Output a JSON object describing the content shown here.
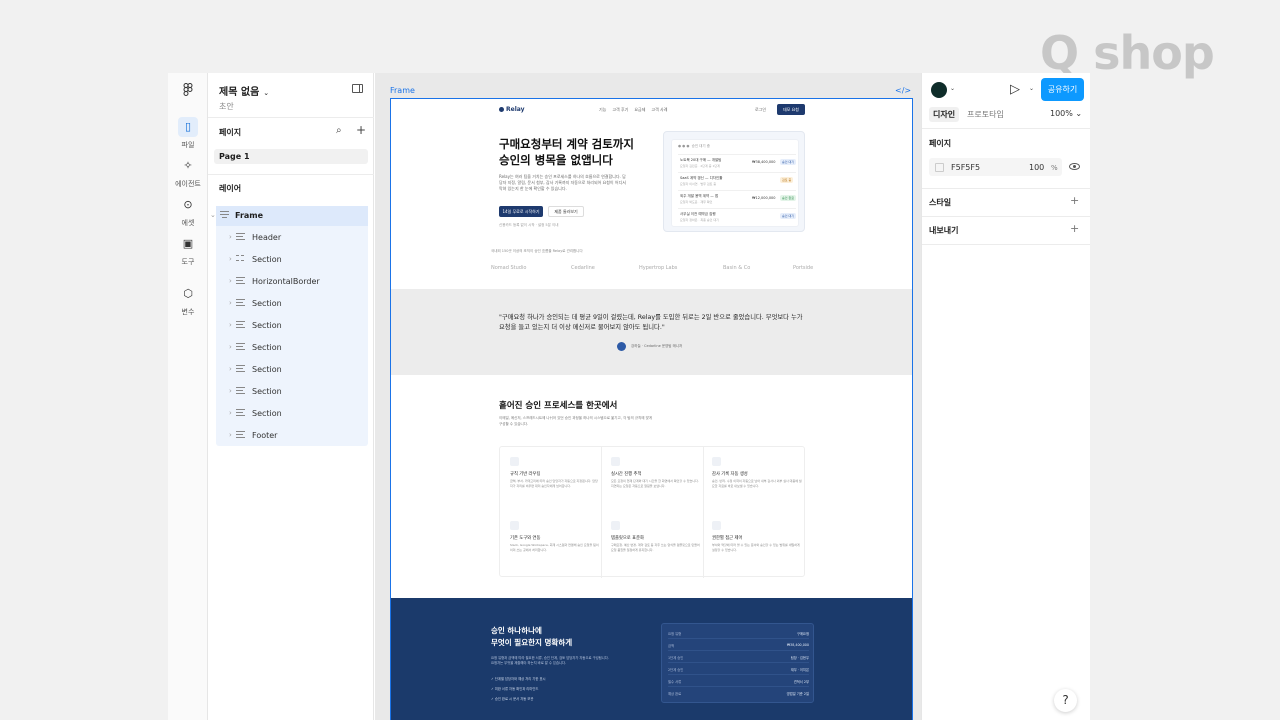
{
  "brand": "Q shop",
  "rail": [
    {
      "label": "파일",
      "icon": "file-icon",
      "active": true
    },
    {
      "label": "에이전트",
      "icon": "sparkle-icon"
    },
    {
      "label": "에셋",
      "icon": "asset-icon"
    },
    {
      "label": "도구",
      "icon": "toolbox-icon"
    },
    {
      "label": "변수",
      "icon": "variable-icon"
    }
  ],
  "layers_panel": {
    "title": "제목 없음",
    "subtitle": "초안",
    "pages_label": "페이지",
    "page": "Page 1",
    "layers_label": "레이어",
    "frame": "Frame",
    "children": [
      "Header",
      "Section",
      "HorizontalBorder",
      "Section",
      "Section",
      "Section",
      "Section",
      "Section",
      "Section",
      "Footer"
    ]
  },
  "canvas": {
    "frame_label": "Frame",
    "code_label": "</>"
  },
  "site": {
    "logo": "Relay",
    "nav": [
      "기능",
      "고객 후기",
      "요금제",
      "고객 사례"
    ],
    "login": "로그인",
    "cta": "데모 요청",
    "hero_title_1": "구매요청부터 계약 검토까지",
    "hero_title_2": "승인의 병목을 없앱니다",
    "hero_desc": "Relay는 여러 팀을 거치는 승인 프로세스를 하나의 흐름으로 연결합니다. 담당자 지정, 알림, 문서 첨부, 감사 기록까지 자동으로 처리되어 요청이 어디서 막혀 있는지 한 눈에 확인할 수 있습니다.",
    "hero_btn_primary": "14일 무료로 시작하기",
    "hero_btn_secondary": "제품 둘러보기",
    "hero_note": "신용카드 등록 없이 시작 · 설정 5분 이내",
    "mock_title": "승인 대기 중",
    "mock_rows": [
      {
        "t": "노트북 20대 구매 — 개발팀",
        "s": "요청자 김민준 · 2단계 중 1단계",
        "a": "₩38,400,000",
        "b": "승인 대기"
      },
      {
        "t": "SaaS 계약 갱신 — 디자인툴",
        "s": "요청자 이서연 · 법무 검토 중",
        "a": "",
        "b": "검토 중"
      },
      {
        "t": "외주 개발 용역 계약 — 앱",
        "s": "요청자 박도윤 · 재무 확인",
        "a": "₩12,000,000",
        "b": "승인 완료"
      },
      {
        "t": "사무실 이전 예약금 집행",
        "s": "요청자 정하은 · 최종 승인 대기",
        "a": "",
        "b": "승인 대기"
      }
    ],
    "trust": "국내외 150곳 이상의 조직이 승인 흐름을 Relay로 관리합니다",
    "logos": [
      "Nomad Studio",
      "Cedarline",
      "Hypertrop Labs",
      "Basin & Co",
      "Portside"
    ],
    "quote": "\"구매요청 하나가 승인되는 데 평균 9일이 걸렸는데, Relay를 도입한 뒤로는 2일 반으로 줄었습니다. 무엇보다 누가 요청을 들고 있는지 더 이상 메신저로 물어보지 않아도 됩니다.\"",
    "quote_author": "강하늘 · Cedarline 운영팀 매니저",
    "features_title": "흩어진 승인 프로세스를 한곳에서",
    "features_desc": "이메일, 메신저, 스프레드시트에 나뉘어 있던 승인 과정을 하나의 시스템으로 옮기고, 각 팀의 규칙에 맞게 구성할 수 있습니다.",
    "features": [
      {
        "t": "규칙 기반 라우팅",
        "d": "금액, 부서, 카테고리에 따라 승인 담당자가 자동으로 지정됩니다. 담당자가 자리를 비우면 대리 승인자에게 넘어갑니다."
      },
      {
        "t": "실시간 진행 추적",
        "d": "모든 요청의 현재 단계와 대기 시간을 한 화면에서 확인할 수 있습니다. 지연되는 요청은 자동으로 알림을 보냅니다."
      },
      {
        "t": "감사 기록 자동 생성",
        "d": "승인, 반려, 수정 이력이 자동으로 남아 내부 감사나 외부 실사 대응에 필요한 자료를 바로 내보낼 수 있습니다."
      },
      {
        "t": "기존 도구와 연동",
        "d": "Slack, Google Workspace, 회계 시스템과 연결해 승인 요청을 팀이 이미 쓰는 곳에서 처리합니다."
      },
      {
        "t": "템플릿으로 표준화",
        "d": "구매요청, 예산 변경, 계약 검토 등 자주 쓰는 양식을 템플릿으로 만들어 요청 품질을 일정하게 유지합니다."
      },
      {
        "t": "권한별 접근 제어",
        "d": "부서와 역할에 따라 볼 수 있는 문서와 승인할 수 있는 범위를 세밀하게 설정할 수 있습니다."
      }
    ],
    "dark_title_1": "승인 하나하나에",
    "dark_title_2": "무엇이 필요한지 명확하게",
    "dark_desc": "요청 유형과 금액에 따라 필요한 서류, 승인 단계, 검토 담당자가 자동으로 구성됩니다. 요청자는 무엇을 제출해야 하는지 바로 알 수 있습니다.",
    "checks": [
      "단계별 담당자와 예상 처리 기한 표시",
      "미완 서류 자동 확인과 리마인드",
      "승인 완료 시 문서 자동 보관"
    ],
    "table": [
      {
        "k": "요청 유형",
        "v": "구매요청"
      },
      {
        "k": "금액",
        "v": "₩38,400,000"
      },
      {
        "k": "1단계 승인",
        "v": "팀장 · 김현우"
      },
      {
        "k": "2단계 승인",
        "v": "재무 · 이지은"
      },
      {
        "k": "필수 서류",
        "v": "견적서 2부"
      },
      {
        "k": "예상 완료",
        "v": "영업일 기준 2일"
      }
    ]
  },
  "inspector": {
    "share": "공유하기",
    "tab_design": "디자인",
    "tab_prototype": "프로토타입",
    "zoom": "100%",
    "page_label": "페이지",
    "fill_hex": "F5F5F5",
    "fill_opacity": "100",
    "fill_unit": "%",
    "styles_label": "스타일",
    "export_label": "내보내기",
    "bg_color": "#F5F5F5"
  },
  "help": "?"
}
